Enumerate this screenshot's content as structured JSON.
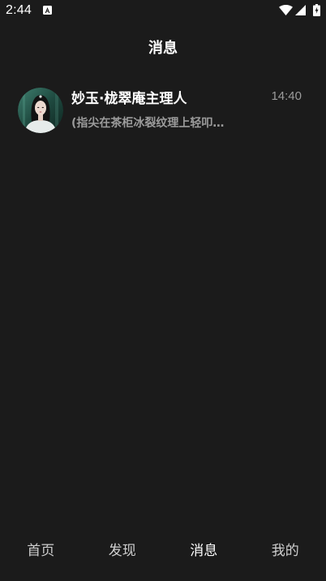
{
  "status_bar": {
    "time": "2:44",
    "icons": [
      "notification-a-icon",
      "wifi-icon",
      "signal-icon",
      "battery-charging-icon"
    ]
  },
  "header": {
    "title": "消息"
  },
  "conversations": [
    {
      "avatar_icon": "avatar-image",
      "name": "妙玉·栊翠庵主理人",
      "time": "14:40",
      "preview": "(指尖在茶柜冰裂纹理上轻叩…"
    }
  ],
  "bottom_nav": {
    "items": [
      {
        "label": "首页",
        "active": false
      },
      {
        "label": "发现",
        "active": false
      },
      {
        "label": "消息",
        "active": true
      },
      {
        "label": "我的",
        "active": false
      }
    ]
  },
  "colors": {
    "background": "#1b1b1b",
    "text_primary": "#ffffff",
    "text_secondary": "#9b9b9b",
    "nav_inactive": "#cfcfcf"
  }
}
